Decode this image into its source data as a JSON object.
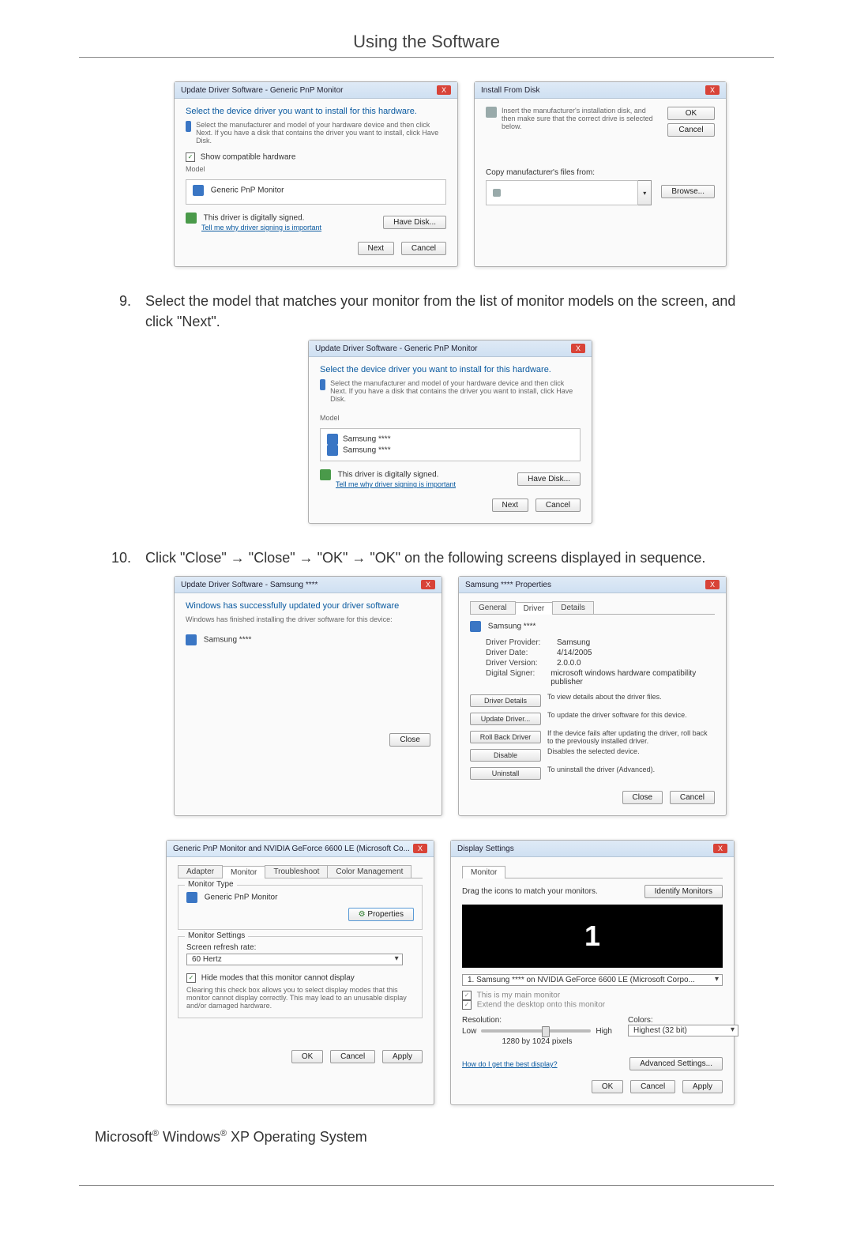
{
  "page": {
    "title": "Using the Software"
  },
  "step9": {
    "number": "9.",
    "text": "Select the model that matches your monitor from the list of monitor models on the screen, and click \"Next\"."
  },
  "step10": {
    "number": "10.",
    "text": "Click \"Close\" → \"Close\" → \"OK\" → \"OK\" on the following screens displayed in sequence."
  },
  "shotA": {
    "title": "Update Driver Software - Generic PnP Monitor",
    "heading": "Select the device driver you want to install for this hardware.",
    "instr": "Select the manufacturer and model of your hardware device and then click Next. If you have a disk that contains the driver you want to install, click Have Disk.",
    "compat_label": "Show compatible hardware",
    "model_label": "Model",
    "model_item": "Generic PnP Monitor",
    "signed": "This driver is digitally signed.",
    "tell_link": "Tell me why driver signing is important",
    "have_disk": "Have Disk...",
    "next": "Next",
    "cancel": "Cancel"
  },
  "shotB": {
    "title": "Install From Disk",
    "instr": "Insert the manufacturer's installation disk, and then make sure that the correct drive is selected below.",
    "ok": "OK",
    "cancel": "Cancel",
    "copy_label": "Copy manufacturer's files from:",
    "browse": "Browse..."
  },
  "shotC": {
    "title": "Update Driver Software - Generic PnP Monitor",
    "heading": "Select the device driver you want to install for this hardware.",
    "instr": "Select the manufacturer and model of your hardware device and then click Next. If you have a disk that contains the driver you want to install, click Have Disk.",
    "model_label": "Model",
    "model_item1": "Samsung ****",
    "model_item2": "Samsung ****",
    "signed": "This driver is digitally signed.",
    "tell_link": "Tell me why driver signing is important",
    "have_disk": "Have Disk...",
    "next": "Next",
    "cancel": "Cancel"
  },
  "shotD": {
    "title": "Update Driver Software - Samsung ****",
    "heading": "Windows has successfully updated your driver software",
    "line": "Windows has finished installing the driver software for this device:",
    "device": "Samsung ****",
    "close": "Close"
  },
  "shotE": {
    "title": "Samsung **** Properties",
    "tabs": {
      "general": "General",
      "driver": "Driver",
      "details": "Details"
    },
    "device": "Samsung ****",
    "rows": {
      "provider_k": "Driver Provider:",
      "provider_v": "Samsung",
      "date_k": "Driver Date:",
      "date_v": "4/14/2005",
      "version_k": "Driver Version:",
      "version_v": "2.0.0.0",
      "signer_k": "Digital Signer:",
      "signer_v": "microsoft windows hardware compatibility publisher"
    },
    "btns": {
      "details": "Driver Details",
      "details_t": "To view details about the driver files.",
      "update": "Update Driver...",
      "update_t": "To update the driver software for this device.",
      "rollback": "Roll Back Driver",
      "rollback_t": "If the device fails after updating the driver, roll back to the previously installed driver.",
      "disable": "Disable",
      "disable_t": "Disables the selected device.",
      "uninstall": "Uninstall",
      "uninstall_t": "To uninstall the driver (Advanced)."
    },
    "close": "Close",
    "cancel": "Cancel"
  },
  "shotF": {
    "title": "Generic PnP Monitor and NVIDIA GeForce 6600 LE (Microsoft Co...",
    "tabs": {
      "adapter": "Adapter",
      "monitor": "Monitor",
      "trouble": "Troubleshoot",
      "color": "Color Management"
    },
    "monitor_type_label": "Monitor Type",
    "monitor_type_value": "Generic PnP Monitor",
    "properties": "Properties",
    "monitor_settings_label": "Monitor Settings",
    "refresh_label": "Screen refresh rate:",
    "refresh_value": "60 Hertz",
    "hide_modes": "Hide modes that this monitor cannot display",
    "hide_modes_expl": "Clearing this check box allows you to select display modes that this monitor cannot display correctly. This may lead to an unusable display and/or damaged hardware.",
    "ok": "OK",
    "cancel": "Cancel",
    "apply": "Apply"
  },
  "shotG": {
    "title": "Display Settings",
    "tab": "Monitor",
    "drag": "Drag the icons to match your monitors.",
    "identify": "Identify Monitors",
    "preview": "1",
    "combo": "1. Samsung **** on NVIDIA GeForce 6600 LE (Microsoft Corpo...",
    "main_chk": "This is my main monitor",
    "extend_chk": "Extend the desktop onto this monitor",
    "resolution_label": "Resolution:",
    "low": "Low",
    "high": "High",
    "res_value": "1280 by 1024 pixels",
    "colors_label": "Colors:",
    "colors_value": "Highest (32 bit)",
    "best_link": "How do I get the best display?",
    "advanced": "Advanced Settings...",
    "ok": "OK",
    "cancel": "Cancel",
    "apply": "Apply"
  },
  "footer": {
    "text_a": "Microsoft",
    "text_b": " Windows",
    "text_c": " XP Operating System",
    "reg": "®"
  }
}
